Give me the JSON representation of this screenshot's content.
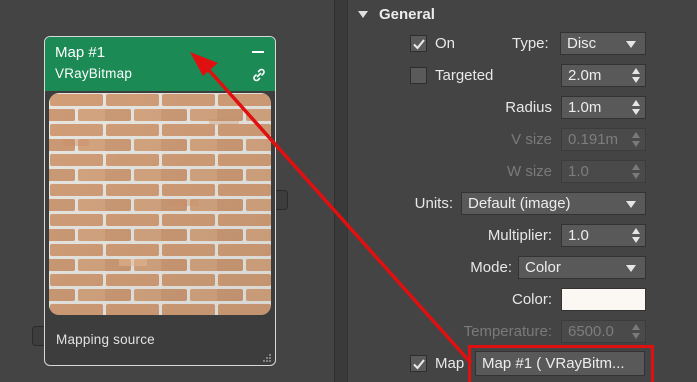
{
  "node": {
    "title": "Map #1",
    "subtitle": "VRayBitmap",
    "footer_label": "Mapping source",
    "header_color": "#1b8a55",
    "texture": "brick-wall"
  },
  "panel": {
    "rollout_title": "General",
    "on": {
      "label": "On",
      "checked": true
    },
    "type": {
      "label": "Type:",
      "value": "Disc"
    },
    "targeted": {
      "label": "Targeted",
      "checked": false,
      "value": "2.0m"
    },
    "radius": {
      "label": "Radius",
      "value": "1.0m"
    },
    "v_size": {
      "label": "V size",
      "value": "0.191m"
    },
    "w_size": {
      "label": "W size",
      "value": "1.0"
    },
    "units": {
      "label": "Units:",
      "value": "Default (image)"
    },
    "multiplier": {
      "label": "Multiplier:",
      "value": "1.0"
    },
    "mode": {
      "label": "Mode:",
      "value": "Color"
    },
    "color": {
      "label": "Color:",
      "value": "#fbf8f4"
    },
    "temperature": {
      "label": "Temperature:",
      "value": "6500.0"
    },
    "map": {
      "label": "Map",
      "checked": true,
      "button_label": "Map #1  ( VRayBitm..."
    }
  },
  "annotation": {
    "arrow_color": "#e01010",
    "highlight_color": "#e01010"
  }
}
